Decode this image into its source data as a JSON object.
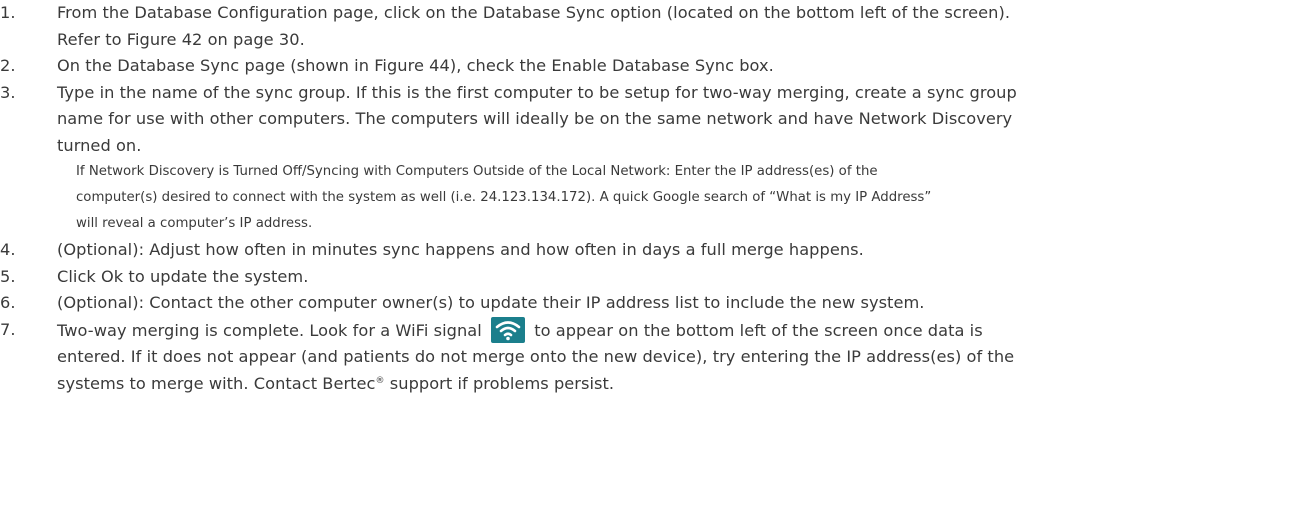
{
  "steps": [
    {
      "number": "1.",
      "lines": [
        "From the Database Configuration page, click on the Database Sync option (located on the bottom left of the screen).",
        "Refer to Figure 42 on page 30."
      ]
    },
    {
      "number": "2.",
      "lines": [
        "On the Database Sync page (shown in Figure 44), check the Enable Database Sync box."
      ]
    },
    {
      "number": "3.",
      "lines": [
        "Type in the name of the sync group. If this is the first computer to be setup for two-way merging, create a sync group",
        "name for use with other computers. The computers will ideally be on the same network and have Network Discovery",
        "turned on."
      ]
    },
    {
      "number": "4.",
      "lines": [
        "(Optional): Adjust how often in minutes sync happens and how often in days a full merge happens."
      ]
    },
    {
      "number": "5.",
      "lines": [
        "Click Ok to update the system."
      ]
    },
    {
      "number": "6.",
      "lines": [
        "(Optional): Contact the other computer owner(s) to update their IP address list to include the new system."
      ]
    },
    {
      "number": "7.",
      "line1_before_icon": "Two-way merging is complete. Look for a WiFi signal",
      "line1_after_icon": "to appear on the bottom left of the screen once data is",
      "line2": "entered. If it does not appear (and patients do not merge onto the new device), try entering the IP address(es) of the",
      "line3_before_mark": "systems to merge with. Contact Bertec",
      "registered_mark": "®",
      "line3_after_mark": " support if problems persist."
    }
  ],
  "note": {
    "lines": [
      "If Network Discovery is Turned Off/Syncing with Computers Outside of the Local Network: Enter the IP address(es) of the",
      "computer(s) desired to connect with the system as well (i.e. 24.123.134.172). A quick Google search of “What is my IP Address”",
      "will reveal a computer’s IP address."
    ]
  },
  "icons": {
    "wifi": {
      "name": "wifi-icon",
      "background": "#1b7f8c",
      "foreground": "#ffffff"
    }
  }
}
